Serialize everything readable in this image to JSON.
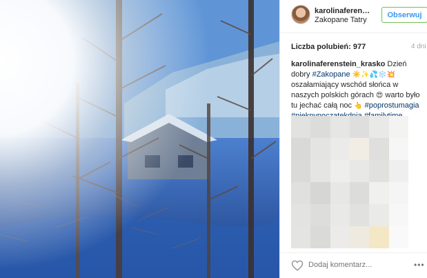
{
  "post": {
    "username": "karolinaferenstein_krasko",
    "location": "Zakopane Tatry",
    "follow_label": "Obserwuj",
    "likes_label": "Liczba polubień: 977",
    "time_ago": "4 dni"
  },
  "caption": {
    "username": "karolinaferenstein_krasko",
    "text_1": "Dzień dobry",
    "tag_zakopane": "#Zakopane",
    "emoji_1": "☀️✨💦❄️💥",
    "text_2": "oszałamiający wschód słońca w naszych polskich górach",
    "emoji_2": "😍",
    "text_3": "warto było tu jechać całą noc",
    "emoji_3": "👆",
    "tag_poprostumagia": "#poprostumagia",
    "tag_pieknypoczatekdnia": "#pieknypoczatekdnia",
    "tag_familytime": "#familytime"
  },
  "footer": {
    "comment_placeholder": "Dodaj komentarz...",
    "more_label": "•••"
  },
  "icons": {
    "heart": "heart-icon",
    "more": "more-options-icon"
  },
  "colors": {
    "follow_border": "#70c050",
    "follow_text": "#3897f0",
    "hashtag": "#003569",
    "muted": "#a5a7aa"
  }
}
